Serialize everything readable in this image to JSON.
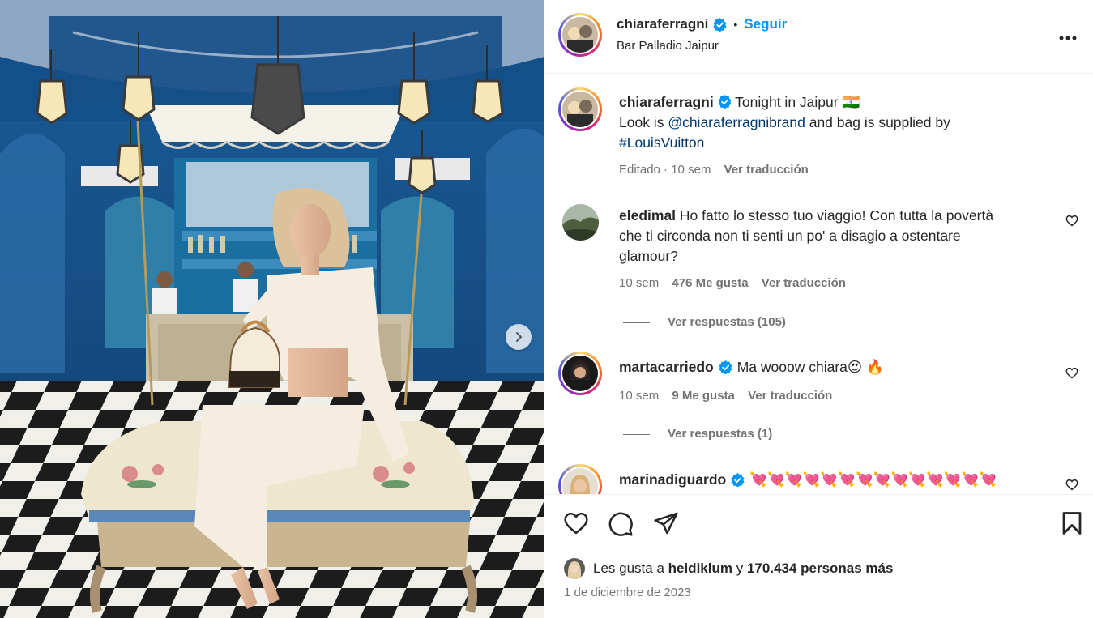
{
  "post": {
    "username": "chiaraferragni",
    "follow_label": "Seguir",
    "dot": "•",
    "location": "Bar Palladio Jaipur",
    "more_label": "•••"
  },
  "caption": {
    "username": "chiaraferragni",
    "line1": "Tonight in Jaipur 🇮🇳",
    "line2_prefix": "Look is ",
    "mention": "@chiaraferragnibrand",
    "line2_suffix": " and bag is supplied by",
    "hashtag": "#LouisVuitton",
    "edited": "Editado",
    "sep": "·",
    "time": "10 sem",
    "translate": "Ver traducción"
  },
  "comments": [
    {
      "username": "eledimal",
      "text_line1": "Ho fatto lo stesso tuo viaggio! Con tutta la povertà",
      "text_line2": "che ti circonda non ti senti un po' a disagio a ostentare",
      "text_line3": "glamour?",
      "time": "10 sem",
      "likes": "476 Me gusta",
      "translate": "Ver traducción",
      "replies": "Ver respuestas (105)"
    },
    {
      "username": "martacarriedo",
      "text": "Ma wooow chiara😍 🔥",
      "time": "10 sem",
      "likes": "9 Me gusta",
      "translate": "Ver traducción",
      "replies": "Ver respuestas (1)"
    },
    {
      "username": "marinadiguardo",
      "text": "💘💘💘💘💘💘💘💘💘💘💘💘💘💘"
    }
  ],
  "likes_bar": {
    "prefix": "Les gusta a ",
    "liker": "heidiklum",
    "middle": " y ",
    "count": "170.434 personas más"
  },
  "date": "1 de diciembre de 2023",
  "icons": {
    "like": "heart-icon",
    "comment": "comment-icon",
    "share": "share-icon",
    "save": "bookmark-icon",
    "more": "more-icon",
    "next": "chevron-right-icon",
    "verified": "verified-badge-icon"
  },
  "colors": {
    "link_blue": "#0095f6",
    "mention_blue": "#00376b",
    "verified_blue": "#0095f6",
    "muted": "#737373"
  }
}
